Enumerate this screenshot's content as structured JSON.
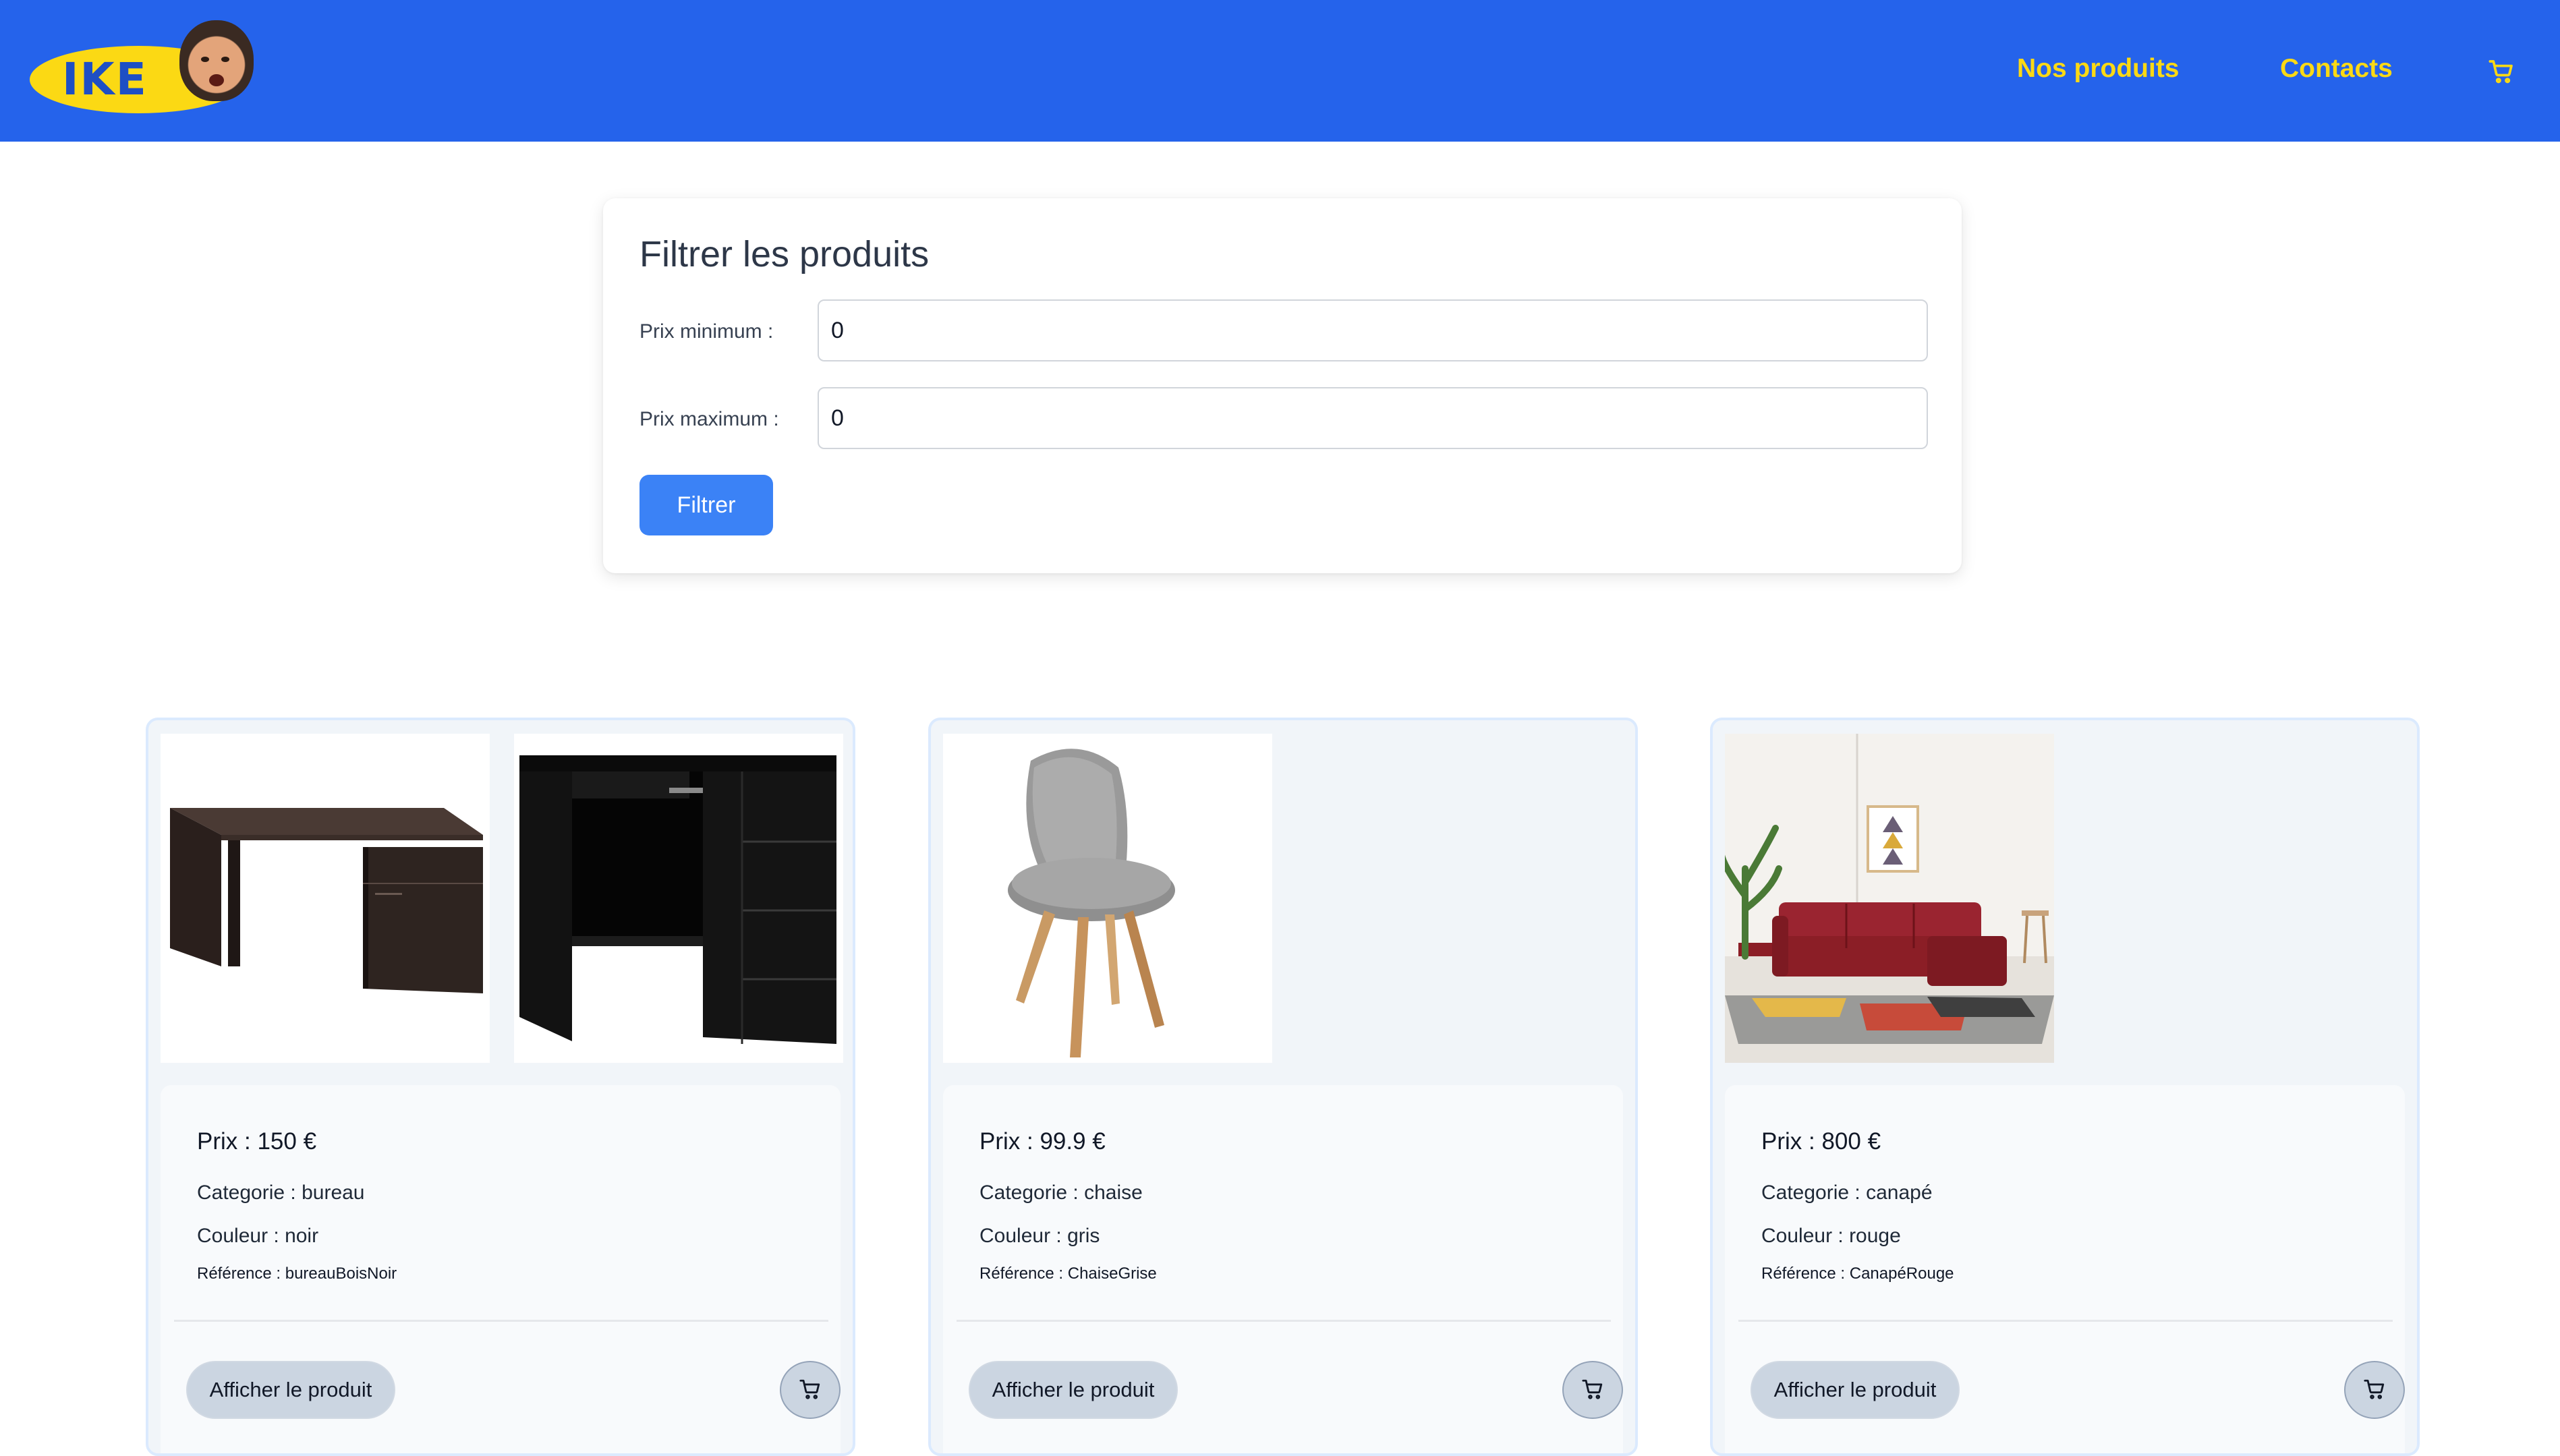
{
  "header": {
    "logo_text": "IKE",
    "nav": {
      "products": "Nos produits",
      "contacts": "Contacts"
    },
    "cart_icon": "cart-icon",
    "colors": {
      "background": "#2563eb",
      "link": "#fbd914"
    }
  },
  "filter": {
    "title": "Filtrer les produits",
    "min_label": "Prix minimum :",
    "min_value": "0",
    "max_label": "Prix maximum :",
    "max_value": "0",
    "button": "Filtrer"
  },
  "products": [
    {
      "price": "Prix : 150 €",
      "category": "Categorie : bureau",
      "color": "Couleur : noir",
      "reference": "Référence : bureauBoisNoir",
      "view_button": "Afficher le produit"
    },
    {
      "price": "Prix : 99.9 €",
      "category": "Categorie : chaise",
      "color": "Couleur : gris",
      "reference": "Référence : ChaiseGrise",
      "view_button": "Afficher le produit"
    },
    {
      "price": "Prix : 800 €",
      "category": "Categorie : canapé",
      "color": "Couleur : rouge",
      "reference": "Référence : CanapéRouge",
      "view_button": "Afficher le produit"
    }
  ]
}
